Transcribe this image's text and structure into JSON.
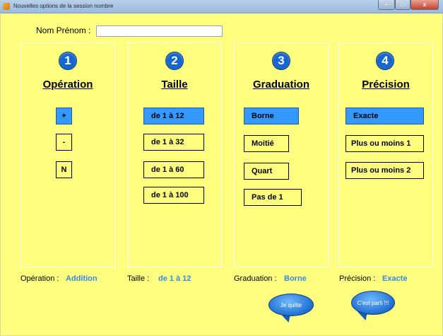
{
  "window": {
    "title": "Nouvelles options de la session nombre",
    "minimize": "–",
    "maximize": "□",
    "close": "x"
  },
  "name_field": {
    "label": "Nom Prénom :",
    "value": ""
  },
  "panels": [
    {
      "number": "1",
      "title": "Opération",
      "options": [
        "+",
        "-",
        "N"
      ],
      "selected_index": 0
    },
    {
      "number": "2",
      "title": "Taille",
      "options": [
        "de 1 à 12",
        "de 1 à 32",
        "de 1 à 60",
        "de 1 à 100"
      ],
      "selected_index": 0
    },
    {
      "number": "3",
      "title": "Graduation",
      "options": [
        "Borne",
        "Moitié",
        "Quart",
        "Pas de 1"
      ],
      "selected_index": 0
    },
    {
      "number": "4",
      "title": "Précision",
      "options": [
        "Exacte",
        "Plus ou moins 1",
        "Plus ou moins 2"
      ],
      "selected_index": 0
    }
  ],
  "summary": {
    "operation_label": "Opération :",
    "operation_value": "Addition",
    "taille_label": "Taille :",
    "taille_value": "de 1 à 12",
    "graduation_label": "Graduation :",
    "graduation_value": "Borne",
    "precision_label": "Précision :",
    "precision_value": "Exacte"
  },
  "buttons": {
    "quit": "Je quitte",
    "start": "C'est parti !!!"
  },
  "colors": {
    "background": "#ffff7f",
    "selected": "#3399ff",
    "accent_text": "#2f8be6",
    "circle": "#1566cf"
  }
}
